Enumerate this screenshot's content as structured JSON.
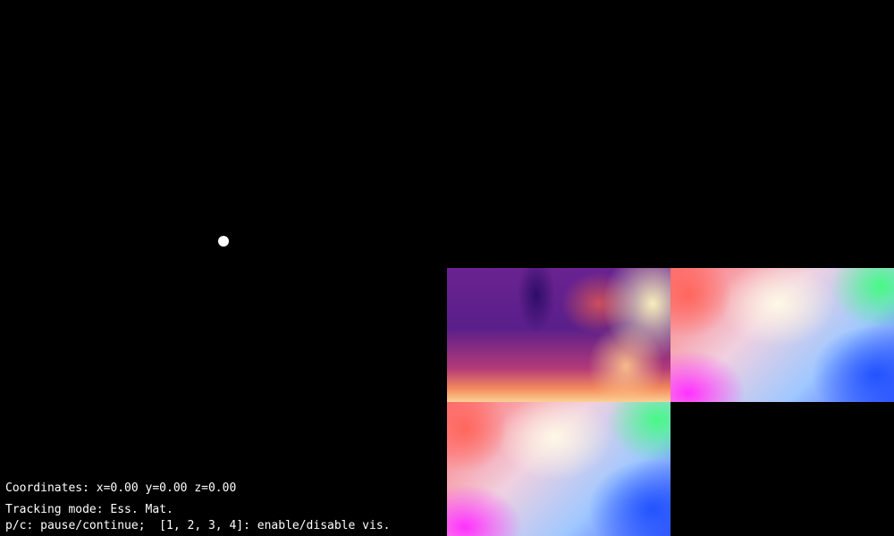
{
  "hud": {
    "coordinates_text": "Coordinates: x=0.00 y=0.00 z=0.00",
    "tracking_mode_text": "Tracking mode: Ess. Mat.",
    "keys_help_text": "p/c: pause/continue;  [1, 2, 3, 4]: enable/disable vis."
  },
  "panels": [
    {
      "name": "depth-map-view",
      "colormap": "magma"
    },
    {
      "name": "optical-flow-view",
      "colormap": "hsv-flow"
    },
    {
      "name": "optical-flow-view-secondary",
      "colormap": "hsv-flow"
    }
  ],
  "colors": {
    "background": "#000000",
    "hud_text": "#ffffff",
    "camera_point": "#ffffff"
  }
}
